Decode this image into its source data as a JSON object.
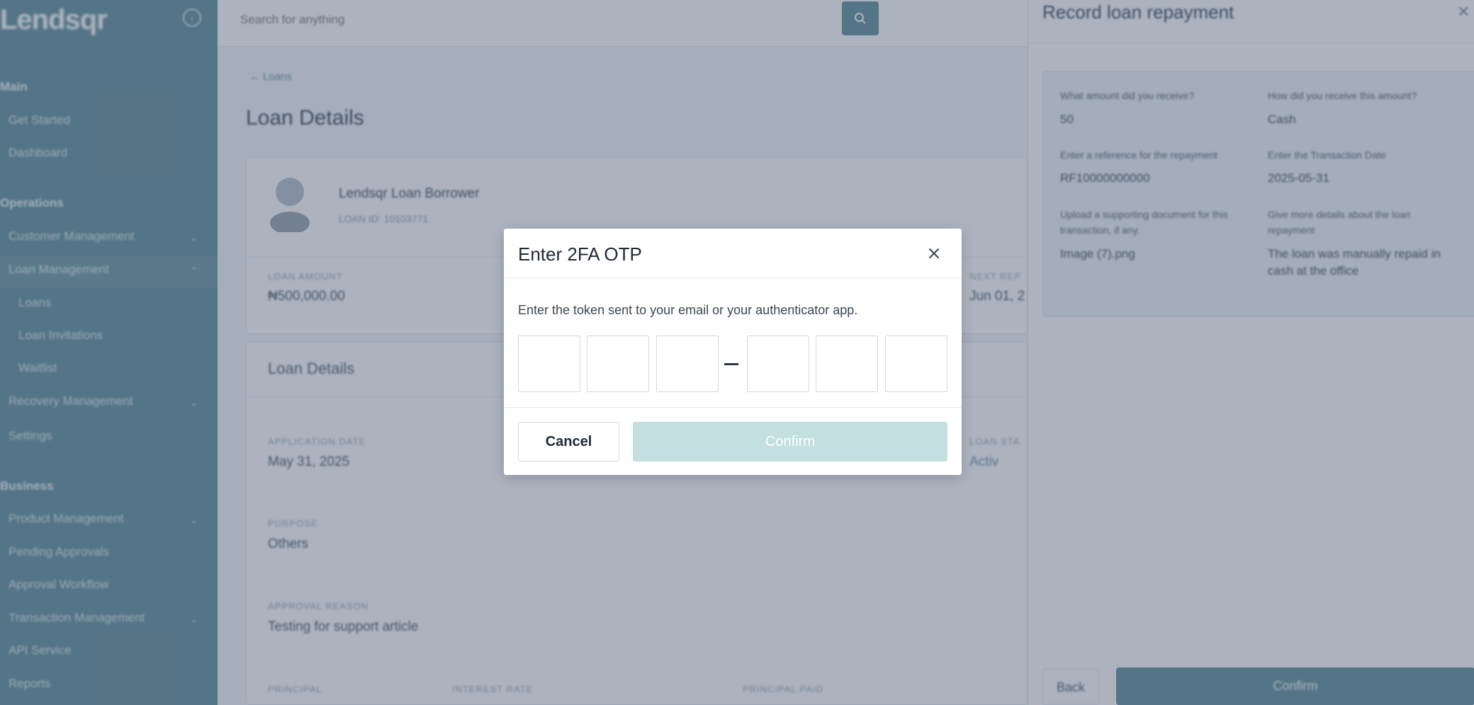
{
  "sidebar": {
    "brand": "Lendsqr",
    "sections": [
      "Main",
      "Operations",
      "Business"
    ],
    "items": {
      "user_guide": "Get Started",
      "dashboard": "Dashboard",
      "customer_management": "Customer Management",
      "loan_management": "Loan Management",
      "loans": "Loans",
      "loan_invitations": "Loan Invitations",
      "waitlist": "Waitlist",
      "recovery_management": "Recovery Management",
      "settings": "Settings",
      "product_management": "Product Management",
      "pending_approvals": "Pending Approvals",
      "approval_workflow": "Approval Workflow",
      "transaction_management": "Transaction Management",
      "api_service": "API Service",
      "reports": "Reports"
    }
  },
  "topbar": {
    "search_placeholder": "Search for anything"
  },
  "main": {
    "breadcrumb": "← Loans",
    "title": "Loan Details",
    "borrower_name": "Lendsqr Loan Borrower",
    "borrower_id": "LOAN ID: 10103771",
    "loan_amount_label": "Loan Amount",
    "loan_amount_value": "₦500,000.00",
    "next_repayment_label": "Next Rep",
    "next_repayment_value": "Jun 01, 2",
    "details_title": "Loan Details",
    "application_date_label": "Application Date",
    "application_date_value": "May 31, 2025",
    "loan_status_label": "Loan Sta",
    "loan_status_value": "Activ",
    "purpose_label": "Purpose",
    "purpose_value": "Others",
    "approval_reason_label": "Approval Reason",
    "approval_reason_value": "Testing for support article",
    "principal_label": "Principal",
    "interest_label": "Interest Rate",
    "principal_paid_label": "Principal Paid"
  },
  "panel": {
    "title": "Record loan repayment",
    "amount_label": "What amount did you receive?",
    "amount_value": "50",
    "method_label": "How did you receive this amount?",
    "method_value": "Cash",
    "reference_label": "Enter a reference for the repayment",
    "reference_value": "RF10000000000",
    "date_label": "Enter the Transaction Date",
    "date_value": "2025-05-31",
    "document_label": "Upload a supporting document for this transaction, if any.",
    "document_value": "Image (7).png",
    "details_label": "Give more details about the loan repayment",
    "details_value": "The loan was manually repaid in cash at the office",
    "back_label": "Back",
    "confirm_label": "Confirm"
  },
  "modal": {
    "title": "Enter 2FA OTP",
    "description": "Enter the token sent to your email or your authenticator app.",
    "otp_values": [
      "",
      "",
      "",
      "",
      "",
      ""
    ],
    "cancel_label": "Cancel",
    "confirm_label": "Confirm",
    "confirm_disabled": true
  },
  "colors": {
    "sidebar_bg": "#5f8f99",
    "accent": "#5f8f99",
    "confirm_disabled_bg": "#c3dfe0",
    "overlay": "rgba(72, 86, 112, 0.45)"
  },
  "icons": {
    "close": "close-icon",
    "search": "search-icon",
    "collapse": "collapse-sidebar-icon",
    "chevron": "chevron-down-icon",
    "avatar": "user-avatar-icon"
  }
}
